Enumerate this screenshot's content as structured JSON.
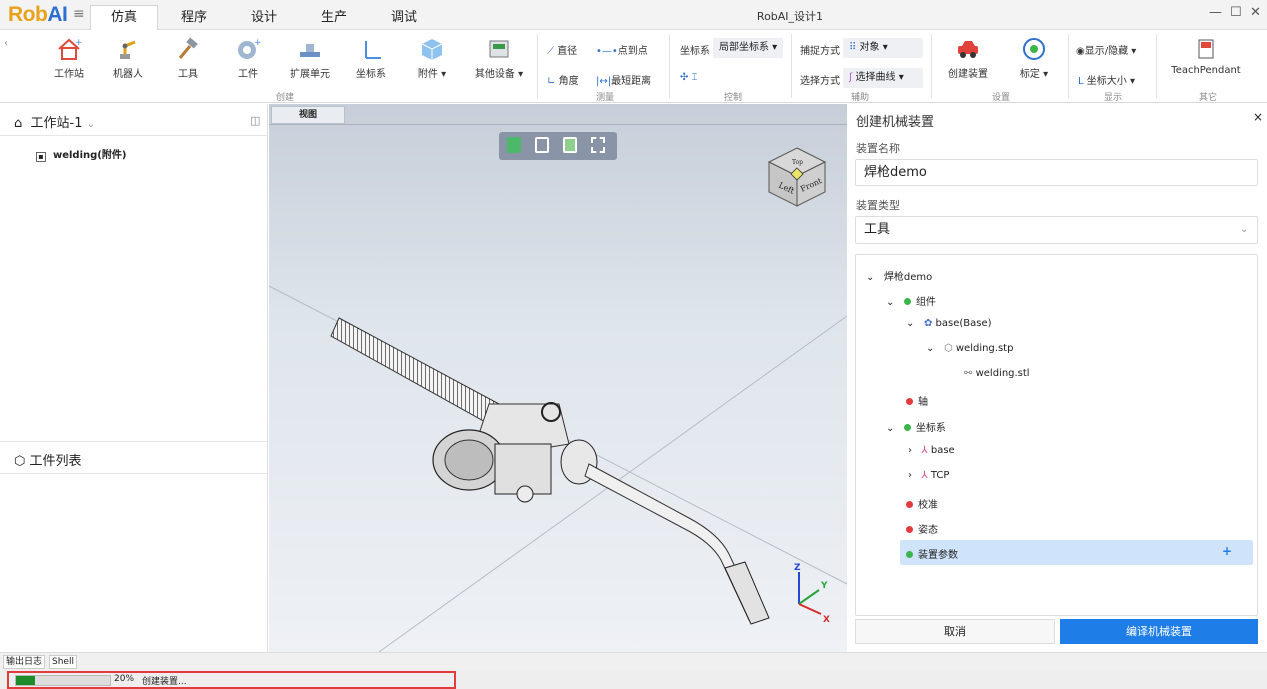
{
  "app": {
    "logo_part1": "Rob",
    "logo_part2": "AI",
    "window_title": "RobAI_设计1"
  },
  "menu_tabs": [
    "仿真",
    "程序",
    "设计",
    "生产",
    "调试"
  ],
  "ribbon": {
    "create": {
      "items": [
        "工作站",
        "机器人",
        "工具",
        "工件",
        "扩展单元",
        "坐标系",
        "附件",
        "其他设备"
      ],
      "group": "创建"
    },
    "measure": {
      "diameter": "直径",
      "point_to_point": "点到点",
      "angle": "角度",
      "shortest": "最短距离",
      "group": "测量"
    },
    "control": {
      "coord_label": "坐标系",
      "coord_value": "局部坐标系",
      "group": "控制"
    },
    "assist": {
      "capture_label": "捕捉方式",
      "capture_value": "对象",
      "select_label": "选择方式",
      "select_value": "选择曲线",
      "group": "辅助"
    },
    "setup": {
      "create_device": "创建装置",
      "calibrate": "标定",
      "group": "设置"
    },
    "display": {
      "show_hide": "显示/隐藏",
      "coord_size": "坐标大小",
      "group": "显示"
    },
    "other": {
      "teach": "TeachPendant",
      "group": "其它"
    }
  },
  "left": {
    "station": "工作站-1",
    "tree_item": "welding(附件)",
    "parts_title": "工件列表"
  },
  "viewport": {
    "tab": "视图",
    "cube_left": "Left",
    "cube_front": "Front",
    "cube_top": "Top",
    "axis_x": "X",
    "axis_y": "Y",
    "axis_z": "Z"
  },
  "right": {
    "title": "创建机械装置",
    "name_label": "装置名称",
    "name_value": "焊枪demo",
    "type_label": "装置类型",
    "type_value": "工具",
    "tree": {
      "root": "焊枪demo",
      "components": "组件",
      "base": "base(Base)",
      "stp": "welding.stp",
      "stl": "welding.stl",
      "axis": "轴",
      "coords": "坐标系",
      "coord_base": "base",
      "coord_tcp": "TCP",
      "calib": "校准",
      "pose": "姿态",
      "params": "装置参数",
      "add": "+"
    },
    "cancel": "取消",
    "compile": "编译机械装置"
  },
  "bottom": {
    "log_tab": "输出日志",
    "shell_tab": "Shell",
    "progress_text": "20%",
    "status": "创建装置...",
    "progress": 0.2
  },
  "colors": {
    "accent": "#1e7de6",
    "selected": "#cfe3fa",
    "progress": "#1f8a2a",
    "highlight": "#e03c3c"
  }
}
